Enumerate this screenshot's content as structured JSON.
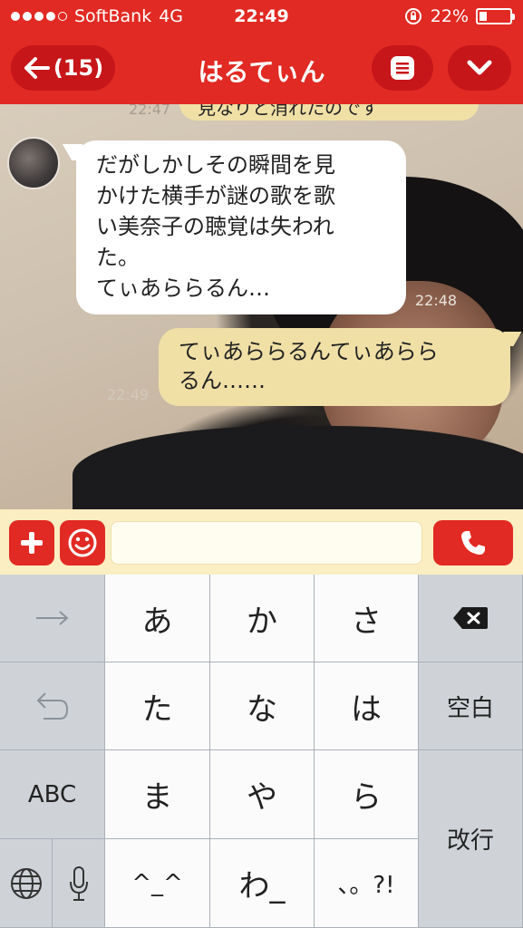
{
  "status_bar": {
    "carrier": "SoftBank",
    "network": "4G",
    "time": "22:49",
    "battery": "22%",
    "battery_level": 0.22
  },
  "nav": {
    "back_label": "(15)",
    "title": "はるてぃん"
  },
  "chat": {
    "partial_top_text": "見なりと消れたのです",
    "partial_top_time": "22:47",
    "incoming": {
      "lines": [
        "だがしかしその瞬間を見",
        "かけた横手が謎の歌を歌",
        "い美奈子の聴覚は失われ",
        "た。",
        "てぃあららるん…"
      ],
      "time": "22:48"
    },
    "outgoing": {
      "lines": [
        "てぃあららるんてぃあらら",
        "るん……"
      ],
      "time": "22:49"
    }
  },
  "input_bar": {
    "placeholder": ""
  },
  "keyboard": {
    "keys": {
      "a": "あ",
      "ka": "か",
      "sa": "さ",
      "ta": "た",
      "na": "な",
      "ha": "は",
      "ma": "ま",
      "ya": "や",
      "ra": "ら",
      "emoticon": "^_^",
      "wa": "わ_",
      "punct": "、。?!",
      "abc": "ABC",
      "space": "空白",
      "enter": "改行"
    }
  },
  "colors": {
    "accent_red": "#e12a23",
    "dark_red": "#c6161a",
    "outgoing_bubble": "#f0e0a6",
    "input_bar_bg": "#fbeec2"
  }
}
